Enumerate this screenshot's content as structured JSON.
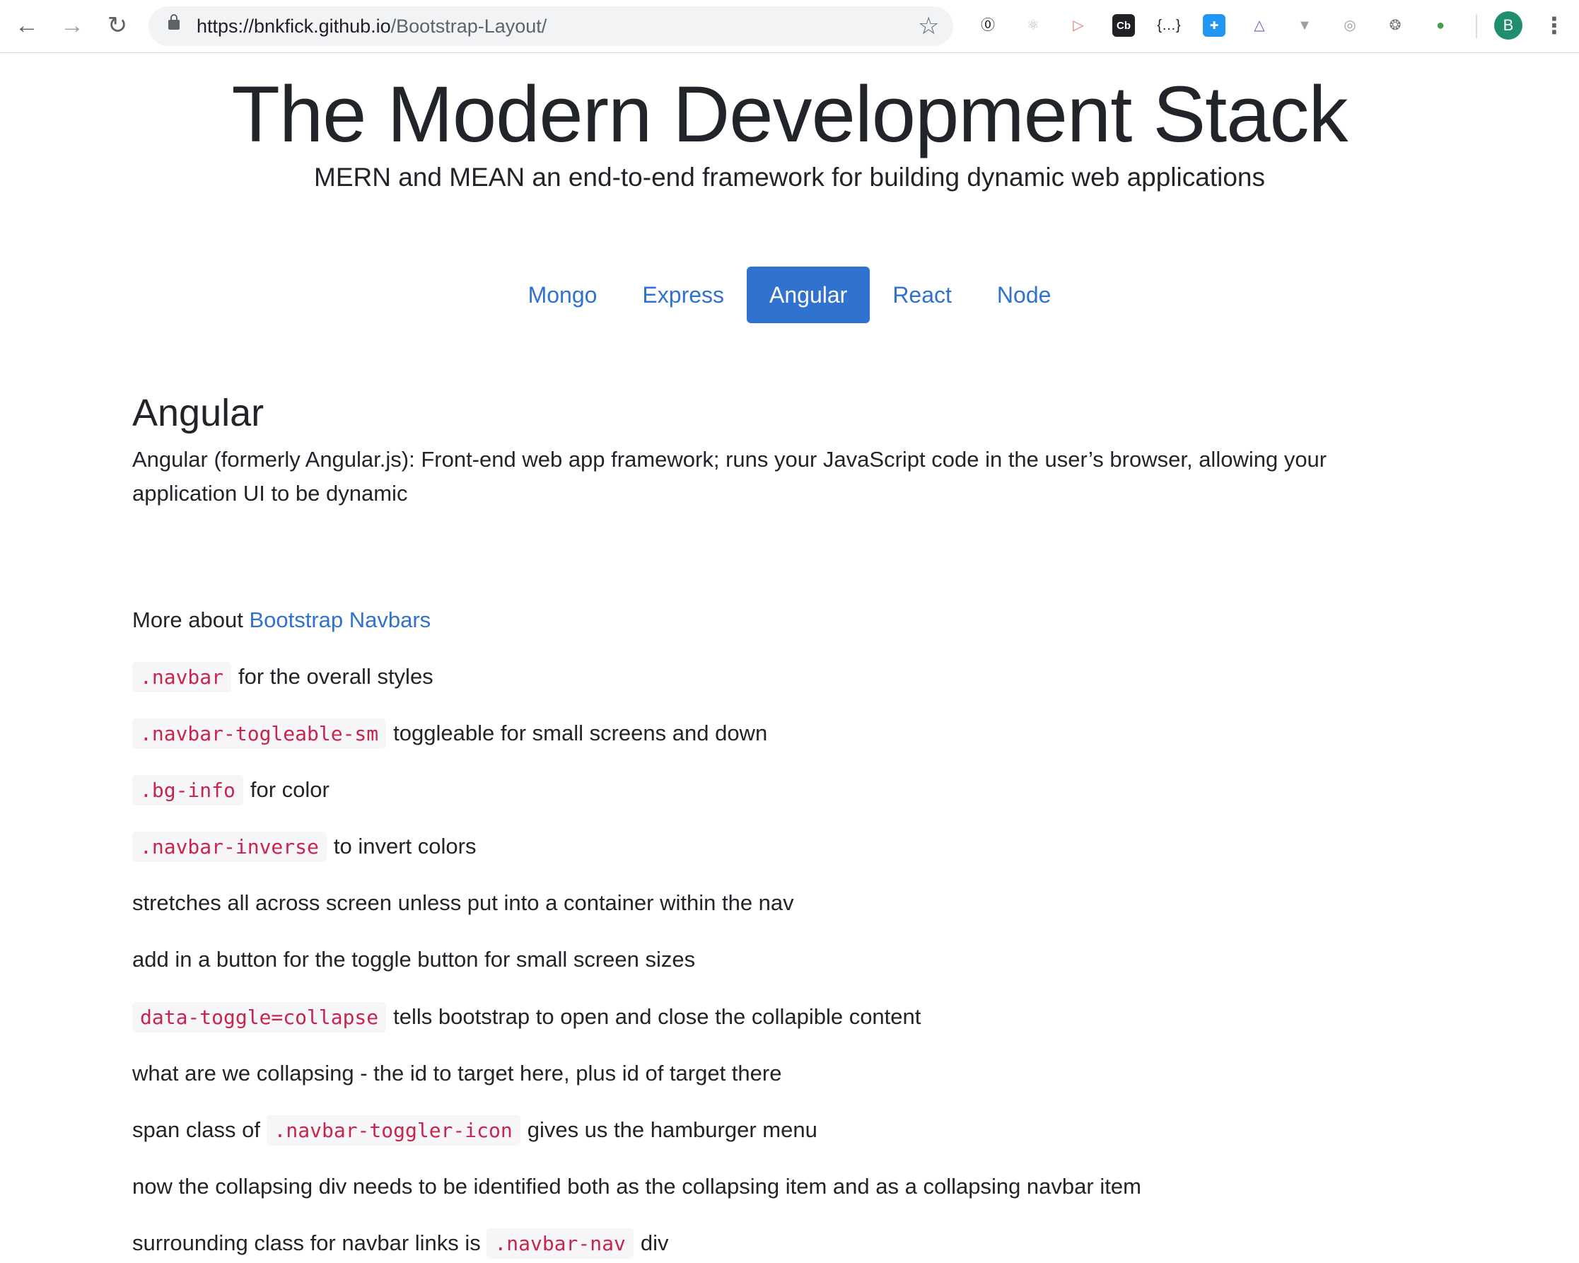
{
  "browser": {
    "url_host": "https://bnkfick.github.io",
    "url_path": "/Bootstrap-Layout/",
    "avatar_initial": "B",
    "extensions": [
      {
        "name": "onepassword-icon",
        "glyph": "⓪",
        "color": "#202124"
      },
      {
        "name": "react-devtools-icon",
        "glyph": "⚛",
        "color": "#bdbdbd"
      },
      {
        "name": "share-arrow-icon",
        "glyph": "▷",
        "color": "#e57373"
      },
      {
        "name": "cb-icon",
        "glyph": "Cb",
        "color": "#ffffff"
      },
      {
        "name": "json-viewer-icon",
        "glyph": "{…}",
        "color": "#202124"
      },
      {
        "name": "plus-extension-icon",
        "glyph": "✚",
        "color": "#ffffff"
      },
      {
        "name": "ruler-icon",
        "glyph": "△",
        "color": "#6a5acd"
      },
      {
        "name": "vue-devtools-icon",
        "glyph": "▼",
        "color": "#9e9e9e"
      },
      {
        "name": "target-icon",
        "glyph": "◎",
        "color": "#9e9e9e"
      },
      {
        "name": "bug-icon",
        "glyph": "❂",
        "color": "#757575"
      },
      {
        "name": "globe-icon",
        "glyph": "●",
        "color": "#43a047"
      }
    ]
  },
  "header": {
    "title": "The Modern Development Stack",
    "subtitle": "MERN and MEAN an end-to-end framework for building dynamic web applications"
  },
  "tabs": [
    {
      "label": "Mongo",
      "active": false
    },
    {
      "label": "Express",
      "active": false
    },
    {
      "label": "Angular",
      "active": true
    },
    {
      "label": "React",
      "active": false
    },
    {
      "label": "Node",
      "active": false
    }
  ],
  "section": {
    "title": "Angular",
    "description": "Angular (formerly Angular.js): Front-end web app framework; runs your JavaScript code in the user’s browser, allowing your application UI to be dynamic"
  },
  "notes": {
    "more_about_prefix": "More about ",
    "more_about_link": "Bootstrap Navbars",
    "items": [
      {
        "code": ".navbar",
        "text": "for the overall styles"
      },
      {
        "code": ".navbar-togleable-sm",
        "text": "toggleable for small screens and down"
      },
      {
        "code": ".bg-info",
        "text": "for color"
      },
      {
        "code": ".navbar-inverse",
        "text": "to invert colors"
      },
      {
        "code": "",
        "text": "stretches all across screen unless put into a container within the nav"
      },
      {
        "code": "",
        "text": "add in a button for the toggle button for small screen sizes"
      },
      {
        "code": "data-toggle=collapse",
        "text": "tells bootstrap to open and close the collapible content"
      },
      {
        "code": "",
        "text": "what are we collapsing - the id to target here, plus id of target there"
      },
      {
        "prefix": "span class of ",
        "code": ".navbar-toggler-icon",
        "text": "gives us the hamburger menu"
      },
      {
        "code": "",
        "text": "now the collapsing div needs to be identified both as the collapsing item and as a collapsing navbar item"
      },
      {
        "prefix": "surrounding class for navbar links is ",
        "code": ".navbar-nav",
        "text": "div"
      }
    ]
  },
  "colors": {
    "accent": "#2f72cf",
    "code_text": "#c7254e",
    "code_bg": "#f6f6f8"
  }
}
